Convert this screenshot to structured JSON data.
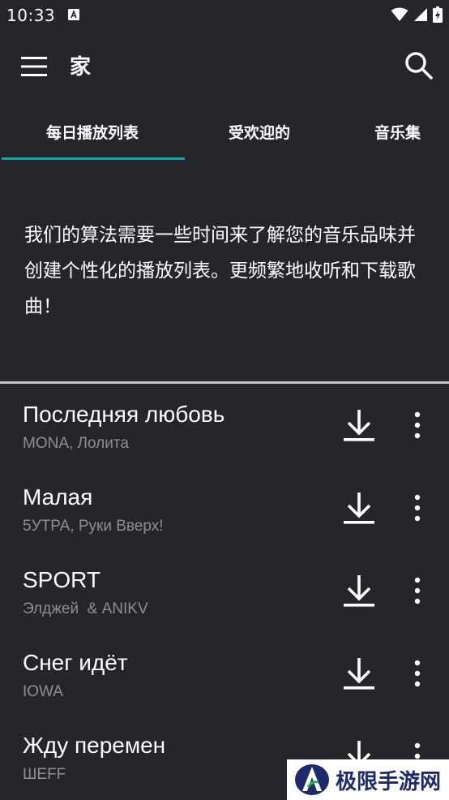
{
  "status_bar": {
    "time": "10:33",
    "notification_icon": "a-notification-icon",
    "icons": [
      "wifi-icon",
      "cell-signal-icon",
      "battery-icon"
    ]
  },
  "toolbar": {
    "title": "家",
    "menu_icon": "hamburger-menu-icon",
    "search_icon": "search-icon"
  },
  "tabs": [
    {
      "label": "每日播放列表",
      "selected": true
    },
    {
      "label": "受欢迎的",
      "selected": false
    },
    {
      "label": "音乐集",
      "selected": false
    }
  ],
  "message": "我们的算法需要一些时间来了解您的音乐品味并创建个性化的播放列表。更频繁地收听和下载歌曲！",
  "songs": [
    {
      "title": "Последняя любовь",
      "artist": "MONA, Лолита"
    },
    {
      "title": "Малая",
      "artist": "5УТРА, Руки Вверх!"
    },
    {
      "title": "SPORT",
      "artist": "Элджей  & ANIKV"
    },
    {
      "title": "Снег идёт",
      "artist": "IOWA"
    },
    {
      "title": "Жду перемен",
      "artist": "ШЕFF"
    }
  ],
  "watermark": {
    "text": "极限手游网"
  },
  "colors": {
    "background": "#25262b",
    "accent": "#18a3b5",
    "secondary_text": "#8e8f93",
    "divider": "#c4c5c8"
  }
}
